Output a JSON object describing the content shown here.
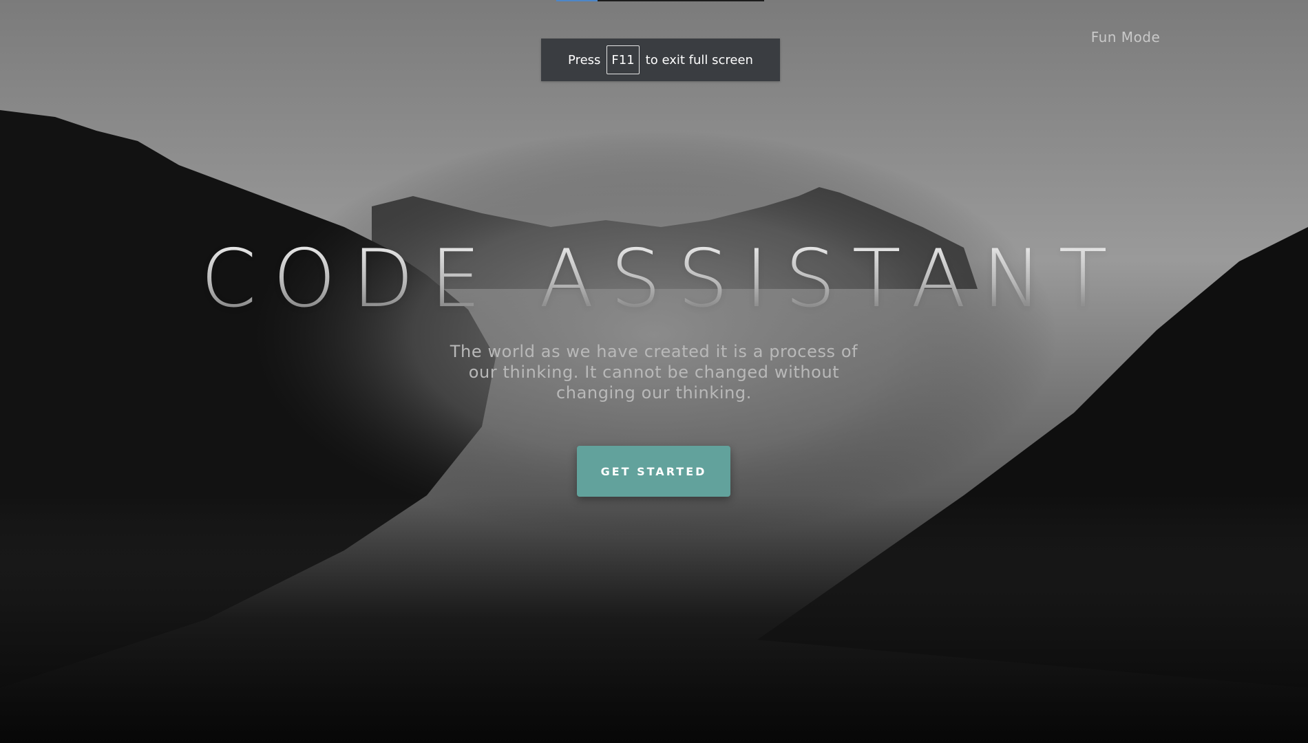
{
  "notice": {
    "press": "Press",
    "key": "F11",
    "rest": "to exit full screen"
  },
  "nav": {
    "fun_mode": "Fun Mode"
  },
  "hero": {
    "title": "CODE ASSISTANT",
    "quote": "The world as we have created it is a process of our thinking. It cannot be changed without changing our thinking.",
    "cta": "GET STARTED"
  },
  "colors": {
    "accent": "#62a29c",
    "notice_bg": "#3a3d41",
    "loading": "#4d86c7"
  }
}
